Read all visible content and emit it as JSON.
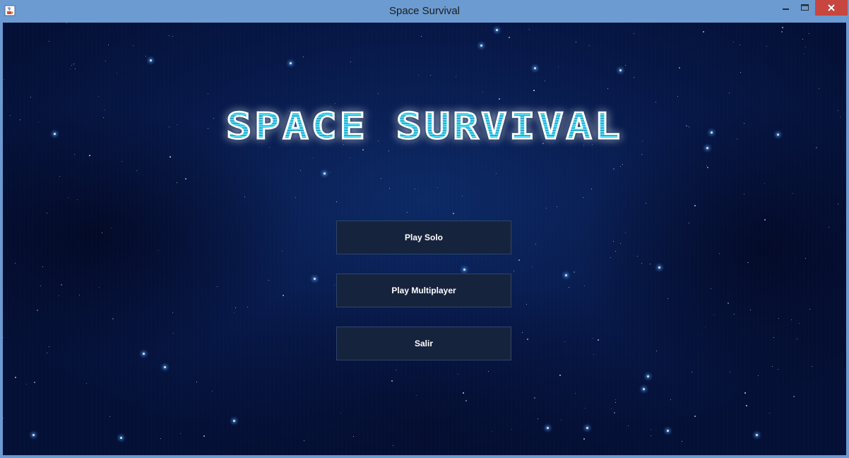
{
  "window": {
    "title": "Space Survival",
    "icon": "java-cup-icon",
    "controls": {
      "minimize": "minimize-icon",
      "maximize": "maximize-icon",
      "close": "close-icon"
    }
  },
  "game": {
    "logo_text": "SPACE SURVIVAL",
    "menu": {
      "play_solo": "Play Solo",
      "play_multiplayer": "Play Multiplayer",
      "exit": "Salir"
    }
  },
  "colors": {
    "titlebar": "#6b9bd1",
    "close_button": "#c7463f",
    "background": "#071848",
    "logo_fill": "#3fc7e6",
    "button_bg": "#16233d"
  }
}
